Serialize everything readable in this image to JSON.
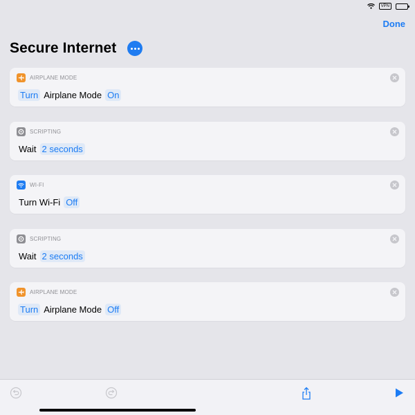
{
  "status_bar": {
    "vpn_label": "VPN",
    "battery_level": 0.3
  },
  "header": {
    "done_label": "Done",
    "title": "Secure Internet"
  },
  "actions": [
    {
      "category": "AIRPLANE MODE",
      "icon": "airplane-icon",
      "icon_color": "#f0932b",
      "parts": [
        {
          "text": "Turn",
          "token": true
        },
        {
          "text": "Airplane Mode",
          "token": false
        },
        {
          "text": "On",
          "token": true
        }
      ]
    },
    {
      "category": "SCRIPTING",
      "icon": "gear-icon",
      "icon_color": "#8e8e93",
      "parts": [
        {
          "text": "Wait",
          "token": false
        },
        {
          "text": "2 seconds",
          "token": true
        }
      ]
    },
    {
      "category": "WI-FI",
      "icon": "wifi-icon",
      "icon_color": "#1f7cf1",
      "parts": [
        {
          "text": "Turn Wi-Fi",
          "token": false
        },
        {
          "text": "Off",
          "token": true
        }
      ]
    },
    {
      "category": "SCRIPTING",
      "icon": "gear-icon",
      "icon_color": "#8e8e93",
      "parts": [
        {
          "text": "Wait",
          "token": false
        },
        {
          "text": "2 seconds",
          "token": true
        }
      ]
    },
    {
      "category": "AIRPLANE MODE",
      "icon": "airplane-icon",
      "icon_color": "#f0932b",
      "parts": [
        {
          "text": "Turn",
          "token": true
        },
        {
          "text": "Airplane Mode",
          "token": false
        },
        {
          "text": "Off",
          "token": true
        }
      ]
    }
  ],
  "toolbar": {
    "undo_icon": "undo-icon",
    "redo_icon": "redo-icon",
    "share_icon": "share-icon",
    "run_icon": "play-icon",
    "accent_color": "#1c7cf4"
  }
}
